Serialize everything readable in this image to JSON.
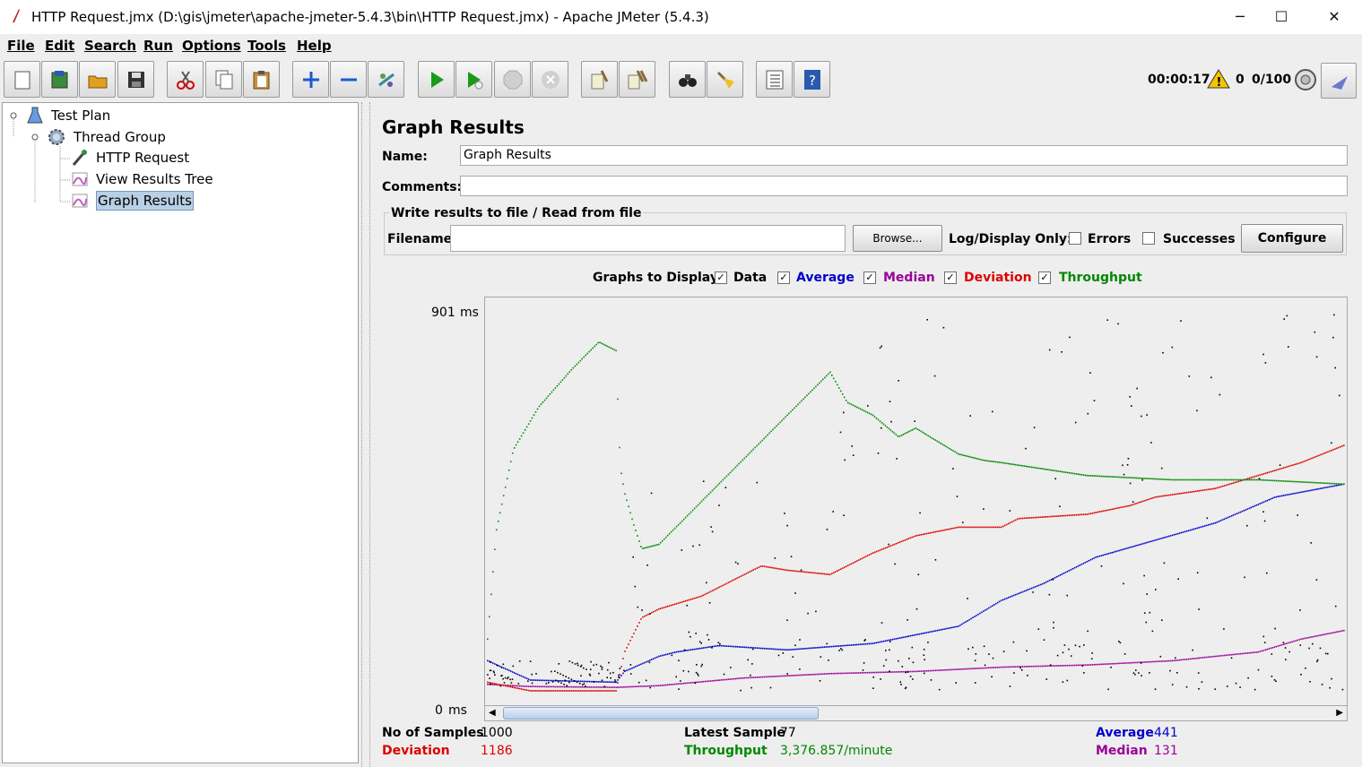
{
  "window": {
    "title": "HTTP Request.jmx (D:\\gis\\jmeter\\apache-jmeter-5.4.3\\bin\\HTTP Request.jmx) - Apache JMeter (5.4.3)",
    "minimize": "─",
    "maximize": "☐",
    "close": "✕"
  },
  "menu": [
    "File",
    "Edit",
    "Search",
    "Run",
    "Options",
    "Tools",
    "Help"
  ],
  "toolbar_icons": [
    "new-icon",
    "templates-icon",
    "open-icon",
    "save-icon",
    "cut-icon",
    "copy-icon",
    "paste-icon",
    "expand-icon",
    "collapse-icon",
    "toggle-icon",
    "start-icon",
    "start-no-pause-icon",
    "stop-icon",
    "shutdown-icon",
    "clear-icon",
    "clear-all-icon",
    "search-icon",
    "reset-search-icon",
    "function-helper-icon",
    "help-icon"
  ],
  "status": {
    "elapsed": "00:00:17",
    "warnings": "0",
    "threads": "0/100"
  },
  "tree": [
    {
      "label": "Test Plan",
      "icon": "test-plan-icon",
      "level": 0
    },
    {
      "label": "Thread Group",
      "icon": "thread-group-icon",
      "level": 1
    },
    {
      "label": "HTTP Request",
      "icon": "http-request-icon",
      "level": 2
    },
    {
      "label": "View Results Tree",
      "icon": "listener-icon",
      "level": 2
    },
    {
      "label": "Graph Results",
      "icon": "listener-icon",
      "level": 2,
      "selected": true
    }
  ],
  "panel": {
    "heading": "Graph Results",
    "name_label": "Name:",
    "name_value": "Graph Results",
    "comments_label": "Comments:",
    "comments_value": "",
    "fieldset_legend": "Write results to file / Read from file",
    "filename_label": "Filename",
    "filename_value": "",
    "browse": "Browse...",
    "log_display": "Log/Display Only:",
    "errors": "Errors",
    "successes": "Successes",
    "configure": "Configure",
    "graphs_to_display": "Graphs to Display",
    "check_mark": "✓",
    "series_toggles": [
      {
        "label": "Data",
        "color": "#000000",
        "checked": true
      },
      {
        "label": "Average",
        "color": "#0000cc",
        "checked": true
      },
      {
        "label": "Median",
        "color": "#990099",
        "checked": true
      },
      {
        "label": "Deviation",
        "color": "#dd0000",
        "checked": true
      },
      {
        "label": "Throughput",
        "color": "#008800",
        "checked": true
      }
    ]
  },
  "chart_data": {
    "type": "scatter",
    "y_max_label": "901",
    "y_min_label": "0",
    "y_unit": "ms",
    "ylim": [
      0,
      901
    ],
    "samples": 1000,
    "series": [
      {
        "name": "Average",
        "color": "#0000cc",
        "x": [
          0,
          5,
          15,
          16,
          20,
          22,
          27,
          35,
          45,
          55,
          60,
          65,
          71,
          78,
          85,
          92,
          100
        ],
        "y": [
          80,
          35,
          30,
          55,
          90,
          100,
          115,
          105,
          120,
          160,
          220,
          260,
          320,
          360,
          400,
          460,
          490
        ]
      },
      {
        "name": "Median",
        "color": "#990099",
        "x": [
          0,
          5,
          15,
          20,
          30,
          40,
          50,
          60,
          70,
          80,
          90,
          95,
          100
        ],
        "y": [
          25,
          20,
          18,
          22,
          40,
          50,
          55,
          65,
          70,
          80,
          100,
          130,
          150
        ]
      },
      {
        "name": "Deviation",
        "color": "#dd0000",
        "x": [
          0,
          5,
          15,
          16,
          18,
          20,
          25,
          32,
          35,
          40,
          45,
          50,
          55,
          60,
          62,
          70,
          75,
          78,
          85,
          90,
          95,
          100
        ],
        "y": [
          30,
          10,
          10,
          100,
          180,
          200,
          230,
          300,
          290,
          280,
          330,
          370,
          390,
          390,
          410,
          420,
          440,
          460,
          480,
          510,
          540,
          580
        ]
      },
      {
        "name": "Throughput",
        "color": "#008800",
        "x": [
          0,
          1,
          3,
          6,
          10,
          13,
          15,
          15.5,
          16,
          17,
          18,
          20,
          25,
          30,
          35,
          40,
          42,
          45,
          48,
          50,
          55,
          58,
          60,
          70,
          80,
          90,
          100
        ],
        "y": [
          130,
          380,
          570,
          670,
          760,
          820,
          800,
          530,
          470,
          400,
          340,
          350,
          450,
          550,
          650,
          750,
          680,
          650,
          600,
          620,
          560,
          545,
          540,
          510,
          500,
          500,
          490
        ]
      },
      {
        "name": "Data",
        "color": "#000000",
        "x": [],
        "y": []
      }
    ]
  },
  "stats": {
    "samples_label": "No of Samples",
    "samples": "1000",
    "latest_label": "Latest Sample",
    "latest": "77",
    "average_label": "Average",
    "average": "441",
    "deviation_label": "Deviation",
    "deviation": "1186",
    "throughput_label": "Throughput",
    "throughput": "3,376.857/minute",
    "median_label": "Median",
    "median": "131"
  }
}
